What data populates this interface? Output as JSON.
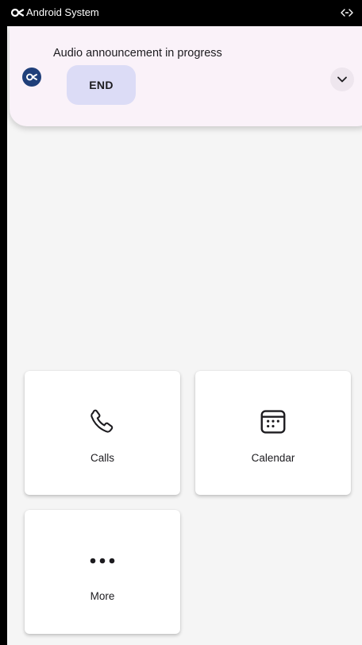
{
  "status_bar": {
    "app_name": "Android System",
    "app_icon": "android-system-logo-icon",
    "right_icon": "link-arrows-icon"
  },
  "notification": {
    "title": "Audio announcement in progress",
    "end_label": "END",
    "avatar_icon": "android-system-logo-icon",
    "expand_icon": "chevron-down-icon"
  },
  "tiles": [
    {
      "label": "Calls",
      "icon": "phone-icon"
    },
    {
      "label": "Calendar",
      "icon": "calendar-icon"
    },
    {
      "label": "More",
      "icon": "more-dots-icon"
    }
  ],
  "colors": {
    "status_bar": "#000000",
    "background": "#f5f5f5",
    "notification_bg": "#faf2f9",
    "end_button_bg": "#dcdcf6",
    "avatar_bg": "#1f3f7a",
    "tile_bg": "#ffffff"
  }
}
